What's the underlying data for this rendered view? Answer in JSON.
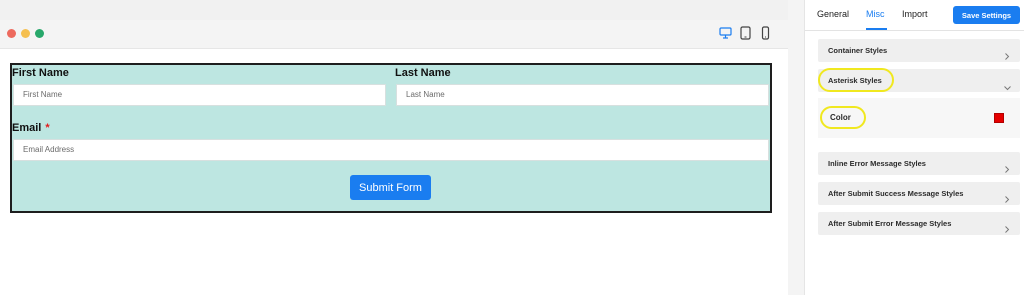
{
  "form": {
    "first_name_label": "First Name",
    "last_name_label": "Last Name",
    "first_name_placeholder": "First Name",
    "last_name_placeholder": "Last Name",
    "email_label": "Email",
    "email_asterisk": "*",
    "email_placeholder": "Email Address",
    "submit_label": "Submit Form"
  },
  "panel": {
    "tabs": [
      {
        "label": "General"
      },
      {
        "label": "Misc"
      },
      {
        "label": "Import"
      }
    ],
    "active_tab": "Misc",
    "save_label": "Save Settings",
    "sections": {
      "container": "Container Styles",
      "asterisk": "Asterisk Styles",
      "color": "Color",
      "inline_error": "Inline Error Message Styles",
      "success": "After Submit Success Message Styles",
      "error": "After Submit Error Message Styles"
    },
    "asterisk_color": "#e50000"
  },
  "colors": {
    "accent": "#1a7df0",
    "form_bg": "#bde6e1",
    "highlight": "#f0e81f"
  },
  "icons": [
    "desktop-icon",
    "tablet-icon",
    "mobile-icon",
    "chevron-right-icon",
    "chevron-down-icon"
  ]
}
